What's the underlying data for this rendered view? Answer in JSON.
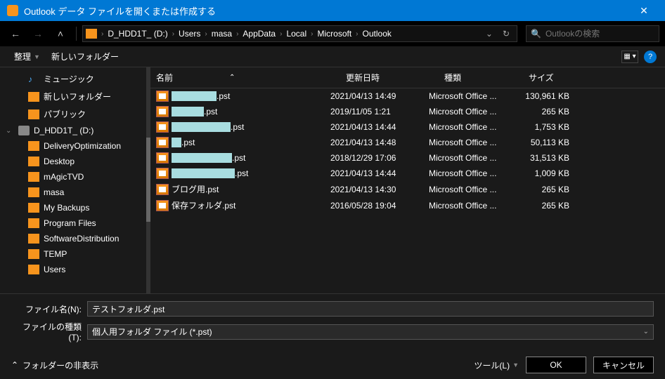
{
  "titlebar": {
    "title": "Outlook データ ファイルを開くまたは作成する"
  },
  "breadcrumb": [
    "D_HDD1T_ (D:)",
    "Users",
    "masa",
    "AppData",
    "Local",
    "Microsoft",
    "Outlook"
  ],
  "search": {
    "placeholder": "Outlookの検索"
  },
  "toolbar": {
    "organize": "整理",
    "newfolder": "新しいフォルダー"
  },
  "columns": {
    "name": "名前",
    "date": "更新日時",
    "type": "種類",
    "size": "サイズ"
  },
  "tree": [
    {
      "label": "ミュージック",
      "icon": "music",
      "indent": 1
    },
    {
      "label": "新しいフォルダー",
      "icon": "folder",
      "indent": 1
    },
    {
      "label": "パブリック",
      "icon": "folder",
      "indent": 1
    },
    {
      "label": "D_HDD1T_ (D:)",
      "icon": "drive",
      "indent": 0,
      "exp": true
    },
    {
      "label": "DeliveryOptimization",
      "icon": "folder",
      "indent": 2
    },
    {
      "label": "Desktop",
      "icon": "folder",
      "indent": 2
    },
    {
      "label": "mAgicTVD",
      "icon": "folder",
      "indent": 2
    },
    {
      "label": "masa",
      "icon": "folder",
      "indent": 2
    },
    {
      "label": "My Backups",
      "icon": "folder",
      "indent": 2
    },
    {
      "label": "Program Files",
      "icon": "folder",
      "indent": 2
    },
    {
      "label": "SoftwareDistribution",
      "icon": "folder",
      "indent": 2
    },
    {
      "label": "TEMP",
      "icon": "folder",
      "indent": 2
    },
    {
      "label": "Users",
      "icon": "folder",
      "indent": 2
    }
  ],
  "files": [
    {
      "redact_w": 64,
      "suffix": ".pst",
      "date": "2021/04/13 14:49",
      "type": "Microsoft Office ...",
      "size": "130,961 KB"
    },
    {
      "redact_w": 46,
      "suffix": ".pst",
      "date": "2019/11/05 1:21",
      "type": "Microsoft Office ...",
      "size": "265 KB"
    },
    {
      "redact_w": 84,
      "suffix": ".pst",
      "date": "2021/04/13 14:44",
      "type": "Microsoft Office ...",
      "size": "1,753 KB"
    },
    {
      "redact_w": 14,
      "suffix": ".pst",
      "date": "2021/04/13 14:48",
      "type": "Microsoft Office ...",
      "size": "50,113 KB"
    },
    {
      "redact_w": 86,
      "suffix": ".pst",
      "date": "2018/12/29 17:06",
      "type": "Microsoft Office ...",
      "size": "31,513 KB"
    },
    {
      "redact_w": 90,
      "suffix": ".pst",
      "date": "2021/04/13 14:44",
      "type": "Microsoft Office ...",
      "size": "1,009 KB"
    },
    {
      "name": "ブログ用.pst",
      "date": "2021/04/13 14:30",
      "type": "Microsoft Office ...",
      "size": "265 KB"
    },
    {
      "name": "保存フォルダ.pst",
      "date": "2016/05/28 19:04",
      "type": "Microsoft Office ...",
      "size": "265 KB"
    }
  ],
  "bottom": {
    "filename_label": "ファイル名(N):",
    "filename_value": "テストフォルダ.pst",
    "filetype_label": "ファイルの種類(T):",
    "filetype_value": "個人用フォルダ ファイル (*.pst)"
  },
  "footer": {
    "hide_folders": "フォルダーの非表示",
    "tools": "ツール(L)",
    "ok": "OK",
    "cancel": "キャンセル"
  }
}
